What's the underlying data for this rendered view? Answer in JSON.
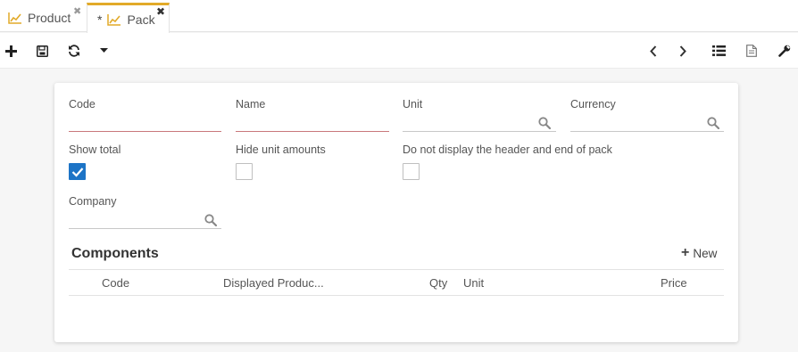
{
  "tabs": [
    {
      "label": "Product",
      "close": "✖"
    },
    {
      "label": "Pack",
      "dirty": "*",
      "close": "✖"
    }
  ],
  "form": {
    "code_label": "Code",
    "name_label": "Name",
    "unit_label": "Unit",
    "currency_label": "Currency",
    "show_total_label": "Show total",
    "hide_unit_amounts_label": "Hide unit amounts",
    "no_header_end_label": "Do not display the header and end of pack",
    "company_label": "Company",
    "show_total_checked": true,
    "hide_unit_amounts_checked": false,
    "no_header_end_checked": false
  },
  "components": {
    "title": "Components",
    "new_label": "New",
    "columns": [
      "Code",
      "Displayed Produc...",
      "Qty",
      "Unit",
      "Price"
    ]
  },
  "colors": {
    "accent_tab": "#e2aa29",
    "checkbox": "#1d74c6",
    "required_line": "#c9787b"
  },
  "icons": {
    "tab": "chart-line-icon",
    "toolbar": [
      "plus-icon",
      "save-icon",
      "refresh-icon",
      "caret-down-icon",
      "chevron-left-icon",
      "chevron-right-icon",
      "list-icon",
      "document-icon",
      "wrench-icon"
    ]
  }
}
